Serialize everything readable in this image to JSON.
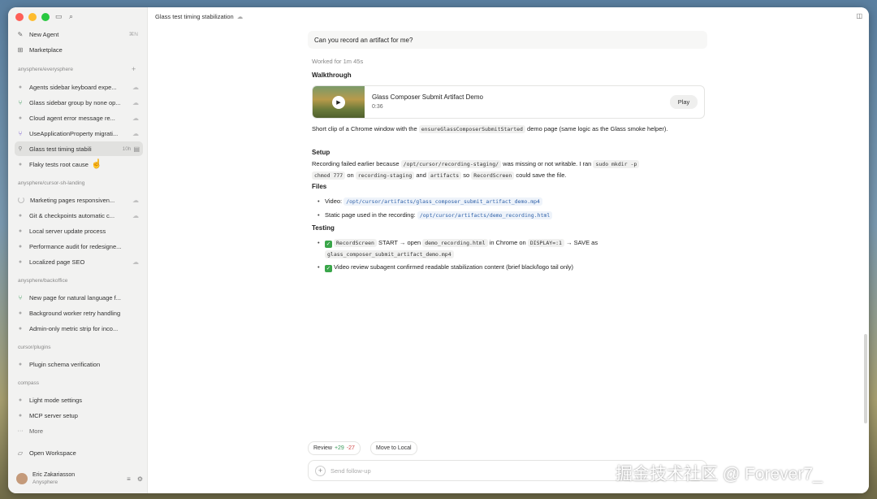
{
  "titlebar": {
    "title": "Glass test timing stabilization"
  },
  "sidebar": {
    "new_agent": {
      "label": "New Agent",
      "shortcut": "⌘N"
    },
    "marketplace": {
      "label": "Marketplace"
    },
    "groups": [
      {
        "name": "anysphere/everysphere",
        "items": [
          {
            "label": "Agents sidebar keyboard expe..."
          },
          {
            "label": "Glass sidebar group by none op..."
          },
          {
            "label": "Cloud agent error message re..."
          },
          {
            "label": "UseApplicationProperty migrati..."
          },
          {
            "label": "Glass test timing stabili",
            "time": "10h"
          },
          {
            "label": "Flaky tests root cause"
          }
        ]
      },
      {
        "name": "anysphere/cursor-sh-landing",
        "items": [
          {
            "label": "Marketing pages responsiven..."
          },
          {
            "label": "Git & checkpoints automatic c..."
          },
          {
            "label": "Local server update process"
          },
          {
            "label": "Performance audit for redesigne..."
          },
          {
            "label": "Localized page SEO"
          }
        ]
      },
      {
        "name": "anysphere/backoffice",
        "items": [
          {
            "label": "New page for natural language f..."
          },
          {
            "label": "Background worker retry handling"
          },
          {
            "label": "Admin-only metric strip for inco..."
          }
        ]
      },
      {
        "name": "cursor/plugins",
        "items": [
          {
            "label": "Plugin schema verification"
          }
        ]
      },
      {
        "name": "compass",
        "items": [
          {
            "label": "Light mode settings"
          },
          {
            "label": "MCP server setup"
          }
        ]
      }
    ],
    "more": "More",
    "open_workspace": "Open Workspace",
    "user": {
      "name": "Eric Zakariasson",
      "org": "Anysphere"
    }
  },
  "chat": {
    "user_message": "Can you record an artifact for me?",
    "worked": "Worked for 1m 45s",
    "walkthrough_heading": "Walkthrough",
    "video": {
      "title": "Glass Composer Submit Artifact Demo",
      "duration": "0:36",
      "play_label": "Play"
    },
    "summary": {
      "p1": "Short clip of a Chrome window with the ",
      "code1": "ensureGlassComposerSubmitStarted",
      "p2": " demo page (same logic as the Glass smoke helper)."
    },
    "setup_heading": "Setup",
    "setup": {
      "t1": "Recording failed earlier because ",
      "c1": "/opt/cursor/recording-staging/",
      "t2": " was missing or not writable. I ran ",
      "c2": "sudo mkdir -p",
      "t3": " and ",
      "c3": "chmod 777",
      "t4": " on ",
      "c4": "recording-staging",
      "t5": " and ",
      "c5": "artifacts",
      "t6": " so ",
      "c6": "RecordScreen",
      "t7": " could save the file."
    },
    "files_heading": "Files",
    "files": [
      {
        "label": "Video: ",
        "path": "/opt/cursor/artifacts/glass_composer_submit_artifact_demo.mp4"
      },
      {
        "label": "Static page used in the recording: ",
        "path": "/opt/cursor/artifacts/demo_recording.html"
      }
    ],
    "testing_heading": "Testing",
    "testing1": {
      "c1": "RecordScreen",
      "t1": " START → open ",
      "c2": "demo_recording.html",
      "t2": " in Chrome on ",
      "c3": "DISPLAY=:1",
      "t3": " → SAVE as ",
      "c4": "glass_composer_submit_artifact_demo.mp4"
    },
    "testing2": {
      "t1": "Video review subagent confirmed readable stabilization content (brief black/logo tail only)"
    }
  },
  "actions": {
    "review": "Review",
    "review_add": "+29",
    "review_del": "-27",
    "move_local": "Move to Local"
  },
  "followup": {
    "placeholder": "Send follow-up"
  },
  "watermark": "掘金技术社区 @ Forever7_"
}
